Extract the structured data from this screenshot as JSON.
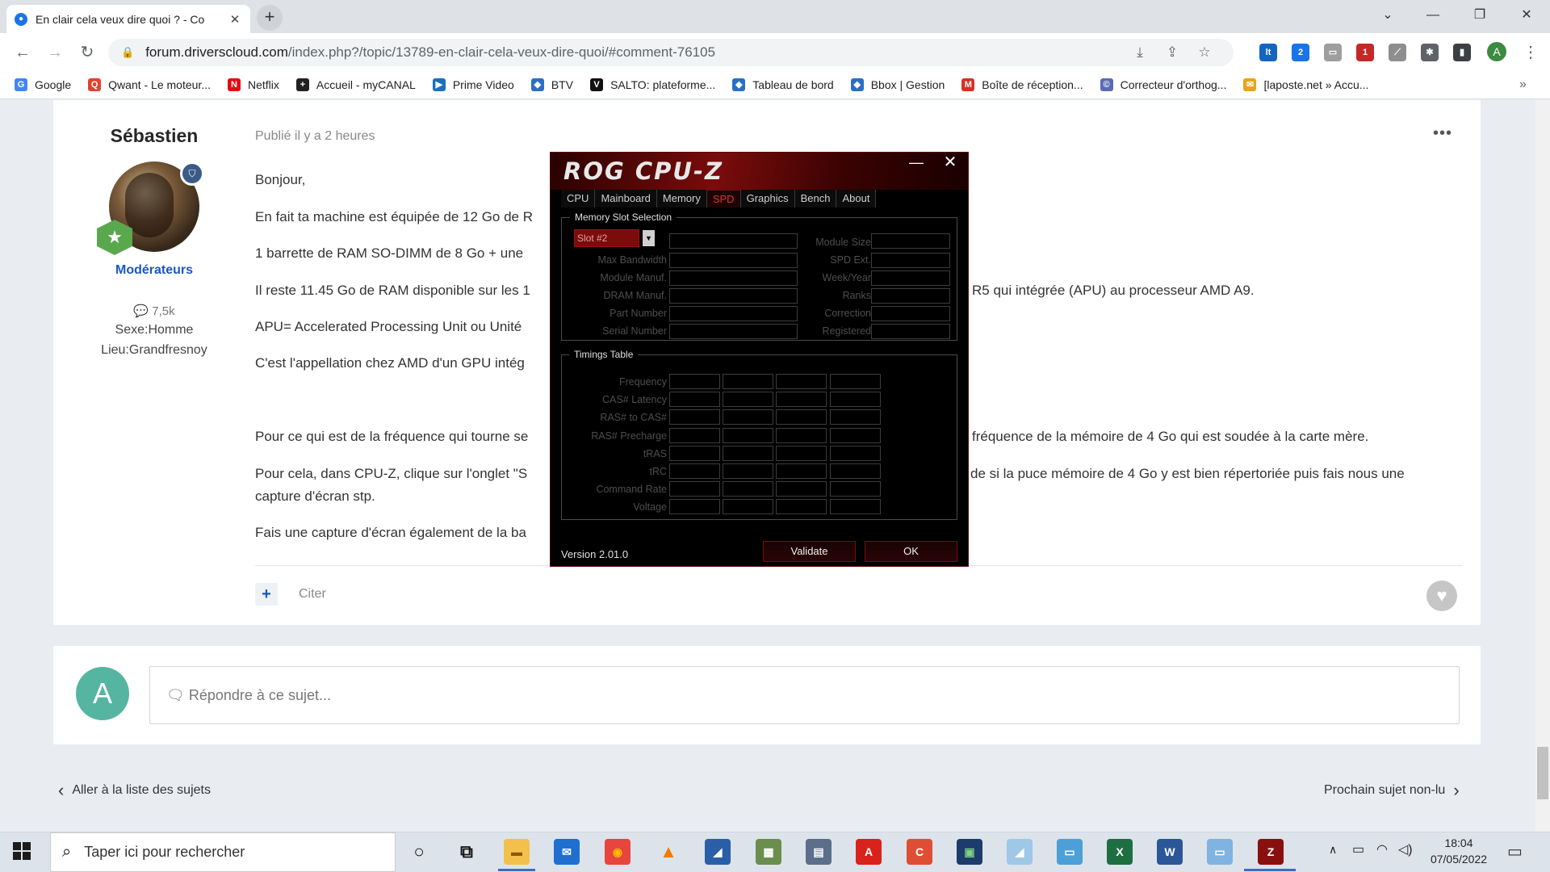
{
  "browser": {
    "tab_title": "En clair cela veux dire quoi ? - Co",
    "tab_close": "✕",
    "new_tab": "+",
    "url_host": "forum.driverscloud.com",
    "url_path": "/index.php?/topic/13789-en-clair-cela-veux-dire-quoi/#comment-76105",
    "profile_initial": "A",
    "window_controls": [
      "⌄",
      "—",
      "❐",
      "✕"
    ],
    "bookmarks": [
      {
        "label": "Google",
        "icon": "G",
        "color": "#4285f4"
      },
      {
        "label": "Qwant - Le moteur...",
        "icon": "Q",
        "color": "#e5412f"
      },
      {
        "label": "Netflix",
        "icon": "N",
        "color": "#e50914"
      },
      {
        "label": "Accueil - myCANAL",
        "icon": "+",
        "color": "#222222"
      },
      {
        "label": "Prime Video",
        "icon": "▶",
        "color": "#1a6fc1"
      },
      {
        "label": "BTV",
        "icon": "◆",
        "color": "#2a6fc4"
      },
      {
        "label": "SALTO: plateforme...",
        "icon": "V",
        "color": "#111111"
      },
      {
        "label": "Tableau de bord",
        "icon": "◆",
        "color": "#2a6fc4"
      },
      {
        "label": "Bbox | Gestion",
        "icon": "◆",
        "color": "#2a6fc4"
      },
      {
        "label": "Boîte de réception...",
        "icon": "M",
        "color": "#d93025"
      },
      {
        "label": "Correcteur d'orthog...",
        "icon": "©",
        "color": "#5b6bb5"
      },
      {
        "label": "[laposte.net » Accu...",
        "icon": "✉",
        "color": "#e8a317"
      }
    ],
    "bookmarks_more": "»"
  },
  "post": {
    "author": "Sébastien",
    "group": "Modérateurs",
    "post_count": "7,5k",
    "sex": "Sexe:Homme",
    "place": "Lieu:Grandfresnoy",
    "date": "Publié il y a 2 heures",
    "menu": "•••",
    "paragraphs": [
      "Bonjour,",
      "En fait ta machine est équipée de 12 Go de R",
      "1 barrette de RAM SO-DIMM de 8 Go + une",
      "Il reste 11.45 Go de RAM disponible sur les 1",
      "R5 qui intégrée (APU) au processeur AMD A9.",
      "APU= Accelerated Processing Unit ou Unité",
      "C'est l'appellation chez AMD d'un GPU intég",
      "Pour ce qui est de la fréquence qui tourne se",
      "fréquence de la mémoire de 4 Go qui est soudée à la carte mère.",
      "Pour cela, dans CPU-Z, clique sur l'onglet \"S",
      "de si la puce mémoire de 4 Go y est bien répertoriée puis fais nous une",
      "capture d'écran stp.",
      "Fais une capture d'écran également de la ba"
    ],
    "quote_label": "Citer",
    "quote_plus": "+"
  },
  "reply": {
    "avatar_initial": "A",
    "placeholder": "Répondre à ce sujet..."
  },
  "nav": {
    "prev": "Aller à la liste des sujets",
    "next": "Prochain sujet non-lu"
  },
  "cpuz": {
    "logo": "ROG CPU-Z",
    "tabs": [
      "CPU",
      "Mainboard",
      "Memory",
      "SPD",
      "Graphics",
      "Bench",
      "About"
    ],
    "active_tab": "SPD",
    "memory_slot_legend": "Memory Slot Selection",
    "slot_value": "Slot #2",
    "left_labels": [
      "Max Bandwidth",
      "Module Manuf.",
      "DRAM Manuf.",
      "Part Number",
      "Serial Number"
    ],
    "right_labels": [
      "Module Size",
      "SPD Ext.",
      "Week/Year",
      "Ranks",
      "Correction",
      "Registered"
    ],
    "timings_legend": "Timings Table",
    "timing_rows": [
      "Frequency",
      "CAS# Latency",
      "RAS# to CAS#",
      "RAS# Precharge",
      "tRAS",
      "tRC",
      "Command Rate",
      "Voltage"
    ],
    "version": "Version 2.01.0",
    "validate": "Validate",
    "ok": "OK"
  },
  "taskbar": {
    "search_placeholder": "Taper ici pour rechercher",
    "time": "18:04",
    "date": "07/05/2022",
    "apps": [
      {
        "name": "cortana-icon",
        "glyph": "○",
        "color": "transparent",
        "text": "#111"
      },
      {
        "name": "task-view-icon",
        "glyph": "⧉",
        "color": "transparent",
        "text": "#111"
      },
      {
        "name": "file-explorer-icon",
        "glyph": "▬",
        "color": "#f3c14b",
        "text": "#8a5a00"
      },
      {
        "name": "mail-icon",
        "glyph": "✉",
        "color": "#1f6fd1",
        "text": "#fff"
      },
      {
        "name": "chrome-icon",
        "glyph": "◉",
        "color": "#e8453c",
        "text": "#fbbc05"
      },
      {
        "name": "vlc-icon",
        "glyph": "▲",
        "color": "transparent",
        "text": "#f07c00"
      },
      {
        "name": "app-blue-icon",
        "glyph": "◢",
        "color": "#2a5fa8",
        "text": "#fff"
      },
      {
        "name": "paint-icon",
        "glyph": "▦",
        "color": "#6b8e4e",
        "text": "#fff"
      },
      {
        "name": "calculator-icon",
        "glyph": "▤",
        "color": "#5b6f8a",
        "text": "#fff"
      },
      {
        "name": "acrobat-icon",
        "glyph": "A",
        "color": "#d9221c",
        "text": "#fff"
      },
      {
        "name": "ccleaner-icon",
        "glyph": "C",
        "color": "#e04d35",
        "text": "#fff"
      },
      {
        "name": "app-green-icon",
        "glyph": "▣",
        "color": "#1d3c6e",
        "text": "#7fd37f"
      },
      {
        "name": "pen-icon",
        "glyph": "◢",
        "color": "#9fc7e8",
        "text": "#fff"
      },
      {
        "name": "screen-icon",
        "glyph": "▭",
        "color": "#4d9fd8",
        "text": "#fff"
      },
      {
        "name": "excel-icon",
        "glyph": "X",
        "color": "#1d6f42",
        "text": "#fff"
      },
      {
        "name": "word-icon",
        "glyph": "W",
        "color": "#2b579a",
        "text": "#fff"
      },
      {
        "name": "device-icon",
        "glyph": "▭",
        "color": "#7fb3e0",
        "text": "#fff"
      },
      {
        "name": "cpuz-taskbar-icon",
        "glyph": "Z",
        "color": "#8a1010",
        "text": "#fff"
      }
    ]
  }
}
